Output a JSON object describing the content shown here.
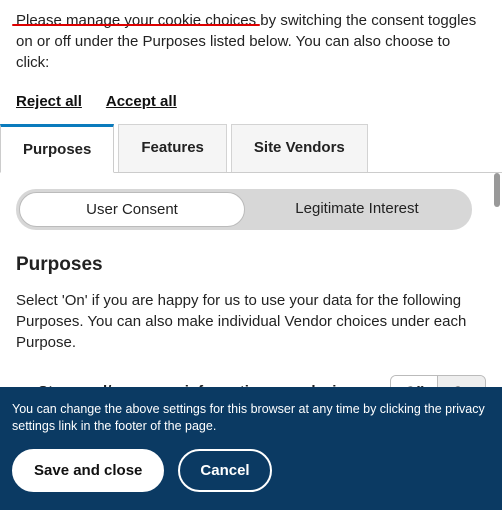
{
  "intro": "Please manage your cookie choices by switching the consent toggles on or off under the Purposes listed below. You can also choose to click:",
  "actions": {
    "reject": "Reject all",
    "accept": "Accept all"
  },
  "tabs": {
    "t1": "Purposes",
    "t2": "Features",
    "t3": "Site Vendors"
  },
  "seg": {
    "uc": "User Consent",
    "li": "Legitimate Interest"
  },
  "section": {
    "heading": "Purposes",
    "desc": "Select 'On' if you are happy for us to use your data for the following Purposes. You can also make individual Vendor choices under each Purpose."
  },
  "row1": {
    "title": "Store and/or access information on a device",
    "off": "Off",
    "on": "On"
  },
  "footer": {
    "note": "You can change the above settings for this browser at any time by clicking the privacy settings link in the footer of the page.",
    "save": "Save and close",
    "cancel": "Cancel"
  }
}
